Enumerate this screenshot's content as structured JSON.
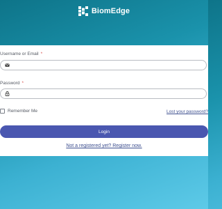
{
  "brand": {
    "name": "BiomEdge",
    "logo_icon": "biomedge-logo-icon",
    "color": "#ffffff"
  },
  "colors": {
    "background_top": "#0e7489",
    "background_bottom": "#5dcae8",
    "primary_button": "#4a57b0",
    "link": "#3d4f8f",
    "required_marker": "#d9534f"
  },
  "form": {
    "username": {
      "label": "Username or Email",
      "required_marker": "*",
      "icon": "envelope-icon",
      "value": "",
      "placeholder": ""
    },
    "password": {
      "label": "Password",
      "required_marker": "*",
      "icon": "lock-icon",
      "value": "",
      "placeholder": ""
    },
    "remember_me": {
      "label": "Remember Me",
      "checked": false
    },
    "lost_password_link": "Lost your password?",
    "login_button": "Login",
    "register_link": "Not a registered yet? Register now."
  }
}
